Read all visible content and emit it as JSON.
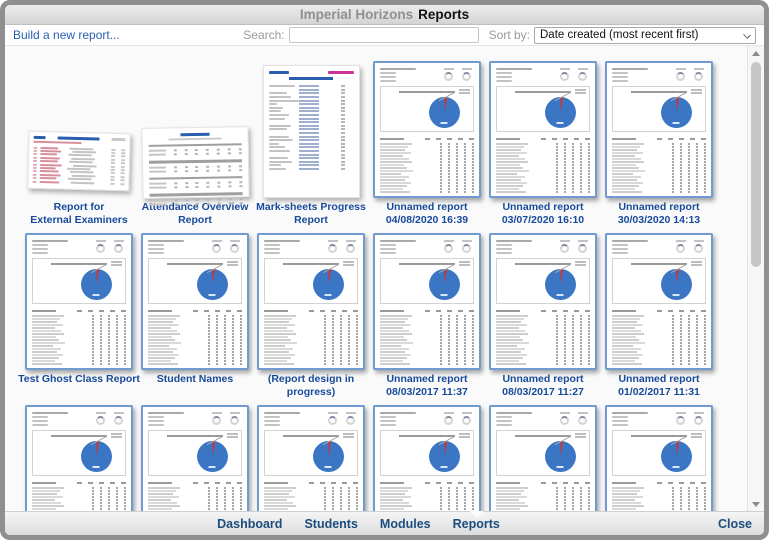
{
  "window": {
    "app_title": "Imperial Horizons",
    "page_title": "Reports"
  },
  "toolbar": {
    "build_link": "Build a new report...",
    "search_label": "Search:",
    "search_value": "",
    "sort_label": "Sort by:",
    "sort_value": "Date created (most recent first)"
  },
  "colors": {
    "label_blue": "#174a9b",
    "link_blue": "#2a5fb0",
    "nav_blue": "#1b4d7e",
    "thumb_border_blue": "#6f9bd1",
    "pie_blue": "#3a76c4",
    "pie_red": "#cc3333"
  },
  "grid": {
    "rows": [
      {
        "items": [
          {
            "type": "doc-landscape-red-table",
            "label_lines": [
              "Report for",
              "External Examiners"
            ]
          },
          {
            "type": "doc-landscape-tables",
            "label_lines": [
              "Attendance Overview",
              "Report"
            ]
          },
          {
            "type": "doc-portrait-list",
            "label_lines": [
              "Mark-sheets Progress",
              "Report"
            ]
          },
          {
            "type": "doc-pie",
            "label_lines": [
              "Unnamed report",
              "04/08/2020 16:39"
            ]
          },
          {
            "type": "doc-pie",
            "label_lines": [
              "Unnamed report",
              "03/07/2020 16:10"
            ]
          },
          {
            "type": "doc-pie",
            "label_lines": [
              "Unnamed report",
              "30/03/2020 14:13"
            ]
          }
        ]
      },
      {
        "items": [
          {
            "type": "doc-pie",
            "label_lines": [
              "Test Ghost Class Report"
            ]
          },
          {
            "type": "doc-pie",
            "label_lines": [
              "Student Names"
            ]
          },
          {
            "type": "doc-pie",
            "label_lines": [
              "(Report design in",
              "progress)"
            ]
          },
          {
            "type": "doc-pie",
            "label_lines": [
              "Unnamed report",
              "08/03/2017 11:37"
            ]
          },
          {
            "type": "doc-pie",
            "label_lines": [
              "Unnamed report",
              "08/03/2017 11:27"
            ]
          },
          {
            "type": "doc-pie",
            "label_lines": [
              "Unnamed report",
              "01/02/2017 11:31"
            ]
          }
        ]
      },
      {
        "items": [
          {
            "type": "doc-pie",
            "label_lines": []
          },
          {
            "type": "doc-pie",
            "label_lines": []
          },
          {
            "type": "doc-pie",
            "label_lines": []
          },
          {
            "type": "doc-pie",
            "label_lines": []
          },
          {
            "type": "doc-pie",
            "label_lines": []
          },
          {
            "type": "doc-pie",
            "label_lines": []
          }
        ]
      }
    ]
  },
  "nav": {
    "items": [
      "Dashboard",
      "Students",
      "Modules",
      "Reports"
    ],
    "active": "Reports",
    "close_label": "Close"
  }
}
